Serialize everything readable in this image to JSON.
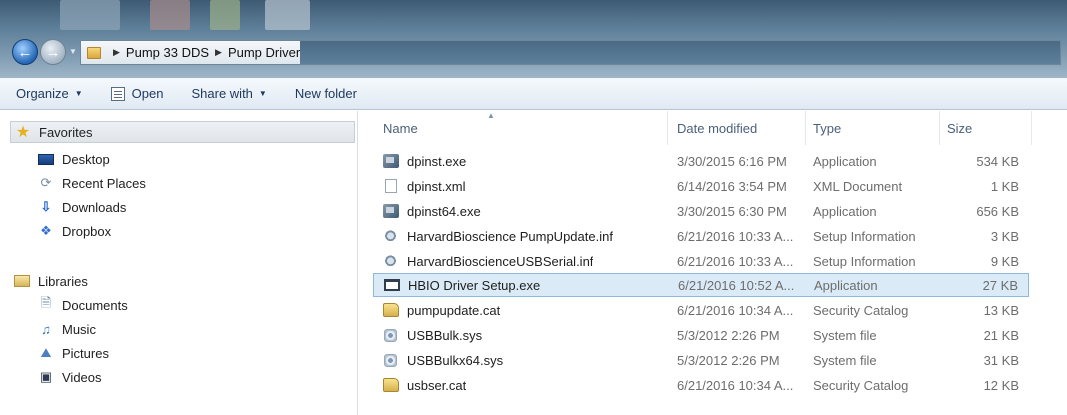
{
  "address_bar": {
    "breadcrumbs": [
      "Pump 33 DDS",
      "Pump Drivers"
    ]
  },
  "toolbar": {
    "organize": "Organize",
    "open": "Open",
    "share_with": "Share with",
    "new_folder": "New folder"
  },
  "nav": {
    "favorites": "Favorites",
    "desktop": "Desktop",
    "recent_places": "Recent Places",
    "downloads": "Downloads",
    "dropbox": "Dropbox",
    "libraries": "Libraries",
    "documents": "Documents",
    "music": "Music",
    "pictures": "Pictures",
    "videos": "Videos"
  },
  "columns": {
    "name": "Name",
    "date_modified": "Date modified",
    "type": "Type",
    "size": "Size"
  },
  "files": [
    {
      "name": "dpinst.exe",
      "date": "3/30/2015 6:16 PM",
      "type": "Application",
      "size": "534 KB",
      "icon": "installer-exe-icon"
    },
    {
      "name": "dpinst.xml",
      "date": "6/14/2016 3:54 PM",
      "type": "XML Document",
      "size": "1 KB",
      "icon": "xml-file-icon"
    },
    {
      "name": "dpinst64.exe",
      "date": "3/30/2015 6:30 PM",
      "type": "Application",
      "size": "656 KB",
      "icon": "installer-exe-icon"
    },
    {
      "name": "HarvardBioscience PumpUpdate.inf",
      "date": "6/21/2016 10:33 A...",
      "type": "Setup Information",
      "size": "3 KB",
      "icon": "setup-info-icon"
    },
    {
      "name": "HarvardBioscienceUSBSerial.inf",
      "date": "6/21/2016 10:33 A...",
      "type": "Setup Information",
      "size": "9 KB",
      "icon": "setup-info-icon"
    },
    {
      "name": "HBIO Driver Setup.exe",
      "date": "6/21/2016 10:52 A...",
      "type": "Application",
      "size": "27 KB",
      "icon": "application-window-icon"
    },
    {
      "name": "pumpupdate.cat",
      "date": "6/21/2016 10:34 A...",
      "type": "Security Catalog",
      "size": "13 KB",
      "icon": "security-catalog-icon"
    },
    {
      "name": "USBBulk.sys",
      "date": "5/3/2012 2:26 PM",
      "type": "System file",
      "size": "21 KB",
      "icon": "system-file-icon"
    },
    {
      "name": "USBBulkx64.sys",
      "date": "5/3/2012 2:26 PM",
      "type": "System file",
      "size": "31 KB",
      "icon": "system-file-icon"
    },
    {
      "name": "usbser.cat",
      "date": "6/21/2016 10:34 A...",
      "type": "Security Catalog",
      "size": "12 KB",
      "icon": "security-catalog-icon"
    }
  ],
  "selected_file": "HBIO Driver Setup.exe"
}
